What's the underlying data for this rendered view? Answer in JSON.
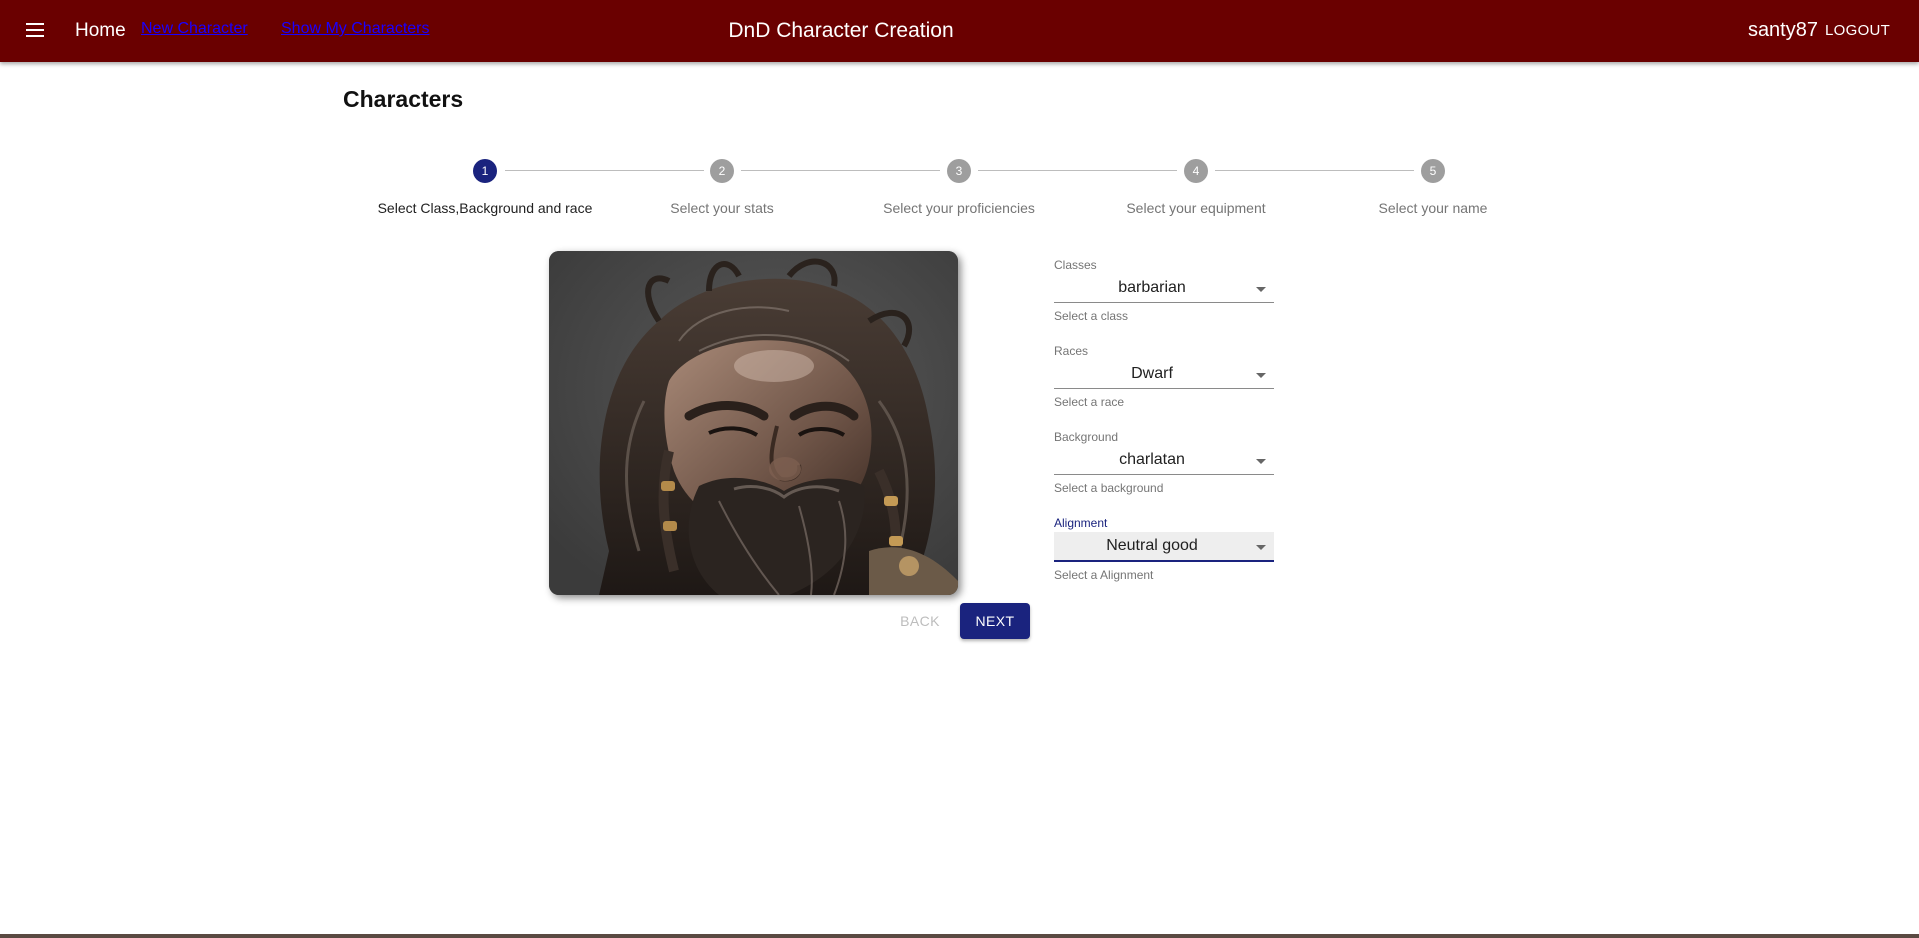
{
  "header": {
    "menu_icon": "hamburger-menu-icon",
    "home": "Home",
    "nav_links": [
      "New Character",
      "Show My Characters"
    ],
    "title": "DnD Character Creation",
    "username": "santy87",
    "logout": "LOGOUT",
    "colors": {
      "appbar": "#6a0000",
      "link": "#1a00ff"
    }
  },
  "page": {
    "title": "Characters"
  },
  "stepper": {
    "active_step": 1,
    "steps": [
      {
        "number": "1",
        "label": "Select Class,Background and race"
      },
      {
        "number": "2",
        "label": "Select your stats"
      },
      {
        "number": "3",
        "label": "Select your proficiencies"
      },
      {
        "number": "4",
        "label": "Select your equipment"
      },
      {
        "number": "5",
        "label": "Select your name"
      }
    ],
    "colors": {
      "active": "#1a237e",
      "inactive": "#9e9e9e"
    }
  },
  "portrait": {
    "subject": "bearded dwarf warrior portrait"
  },
  "form": {
    "fields": [
      {
        "label": "Classes",
        "value": "barbarian",
        "helper": "Select a class"
      },
      {
        "label": "Races",
        "value": "Dwarf",
        "helper": "Select a race"
      },
      {
        "label": "Background",
        "value": "charlatan",
        "helper": "Select a background"
      },
      {
        "label": "Alignment",
        "value": "Neutral good",
        "helper": "Select a Alignment",
        "focused": true
      }
    ]
  },
  "buttons": {
    "back": "BACK",
    "next": "NEXT"
  }
}
